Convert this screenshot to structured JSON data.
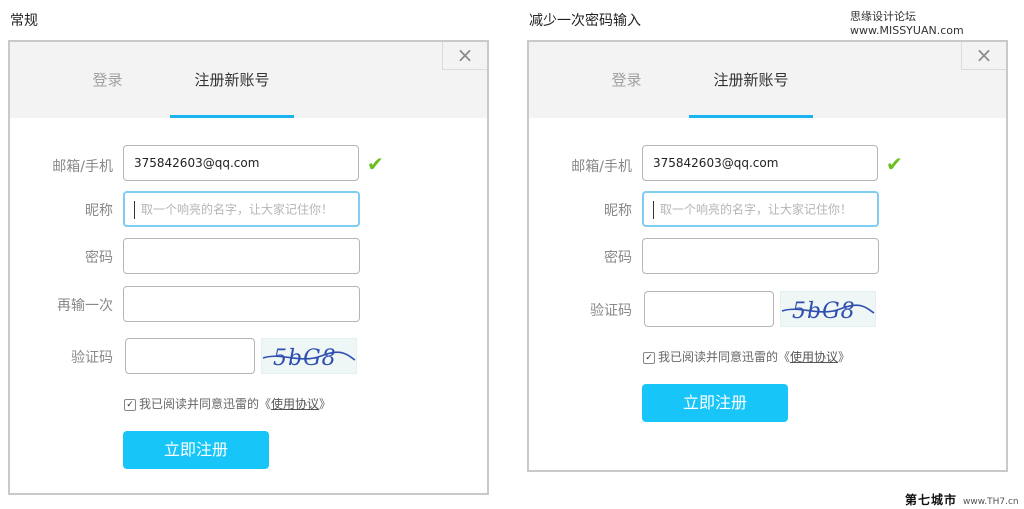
{
  "captions": {
    "left": "常规",
    "right": "减少一次密码输入",
    "site_top": "思缘设计论坛 www.MISSYUAN.com",
    "site_bottom": "第七城市",
    "site_bottom_url": "www.TH7.cn"
  },
  "panel_left": {
    "tabs": [
      "登录",
      "注册新账号"
    ],
    "active_tab": 1,
    "close_icon": "×",
    "fields": {
      "email_label": "邮箱/手机",
      "email_value": "375842603@qq.com",
      "nickname_label": "昵称",
      "nickname_placeholder": "取一个响亮的名字，让大家记住你！",
      "password_label": "密码",
      "password_value": "",
      "repeat_label": "再输一次",
      "repeat_value": "",
      "captcha_label": "验证码",
      "captcha_value": "",
      "captcha_text": "5bG8"
    },
    "agreement": {
      "checked": true,
      "text": "我已阅读并同意迅雷的",
      "link_open": "《",
      "link": "使用协议",
      "link_close": "》"
    },
    "submit": "立即注册"
  },
  "panel_right": {
    "tabs": [
      "登录",
      "注册新账号"
    ],
    "active_tab": 1,
    "close_icon": "×",
    "fields": {
      "email_label": "邮箱/手机",
      "email_value": "375842603@qq.com",
      "nickname_label": "昵称",
      "nickname_placeholder": "取一个响亮的名字，让大家记住你！",
      "password_label": "密码",
      "password_value": "",
      "captcha_label": "验证码",
      "captcha_value": "",
      "captcha_text": "5bG8"
    },
    "agreement": {
      "checked": true,
      "text": "我已阅读并同意迅雷的",
      "link_open": "《",
      "link": "使用协议",
      "link_close": "》"
    },
    "submit": "立即注册"
  },
  "colors": {
    "accent": "#18b4f0",
    "button": "#17c5f8",
    "check": "#6abe1e",
    "focus_border": "#7fcdf2"
  }
}
